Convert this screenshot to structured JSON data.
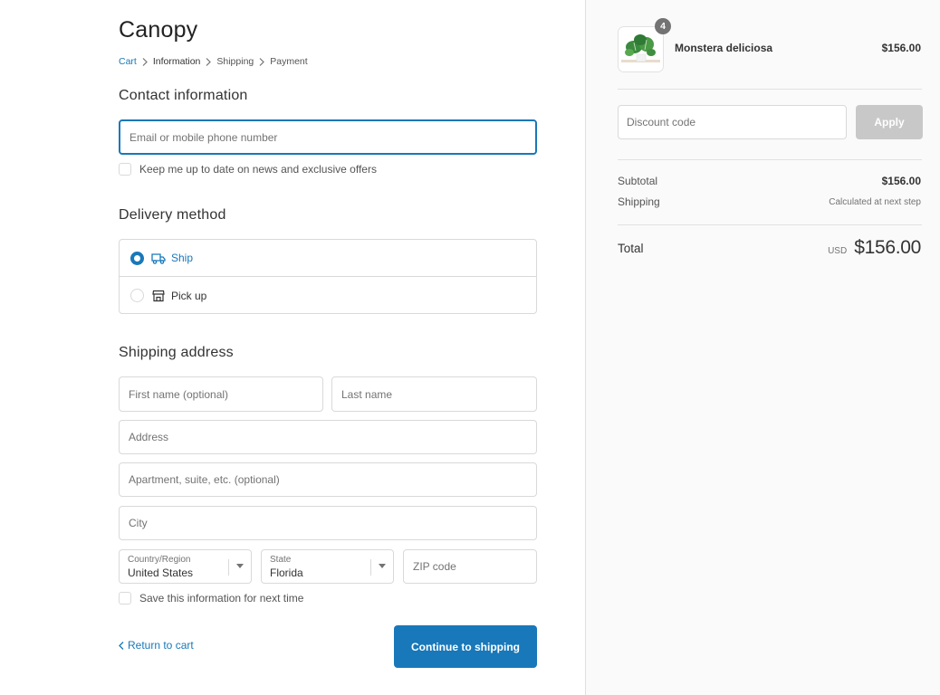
{
  "brand": "Canopy",
  "breadcrumb": {
    "cart": "Cart",
    "information": "Information",
    "shipping": "Shipping",
    "payment": "Payment"
  },
  "contact": {
    "title": "Contact information",
    "email_placeholder": "Email or mobile phone number",
    "newsletter_label": "Keep me up to date on news and exclusive offers"
  },
  "delivery": {
    "title": "Delivery method",
    "ship_label": "Ship",
    "pickup_label": "Pick up"
  },
  "shipping_address": {
    "title": "Shipping address",
    "first_name_placeholder": "First name (optional)",
    "last_name_placeholder": "Last name",
    "address_placeholder": "Address",
    "apartment_placeholder": "Apartment, suite, etc. (optional)",
    "city_placeholder": "City",
    "country_label": "Country/Region",
    "country_value": "United States",
    "state_label": "State",
    "state_value": "Florida",
    "zip_placeholder": "ZIP code",
    "save_info_label": "Save this information for next time"
  },
  "actions": {
    "return_label": "Return to cart",
    "continue_label": "Continue to shipping"
  },
  "summary": {
    "product": {
      "quantity": "4",
      "name": "Monstera deliciosa",
      "price": "$156.00"
    },
    "discount_placeholder": "Discount code",
    "apply_label": "Apply",
    "subtotal_label": "Subtotal",
    "subtotal_value": "$156.00",
    "shipping_label": "Shipping",
    "shipping_value": "Calculated at next step",
    "total_label": "Total",
    "currency": "USD",
    "total_value": "$156.00"
  },
  "colors": {
    "accent": "#1878b9",
    "apply_disabled": "#c8c8c8",
    "sidebar_bg": "#fafafa"
  }
}
